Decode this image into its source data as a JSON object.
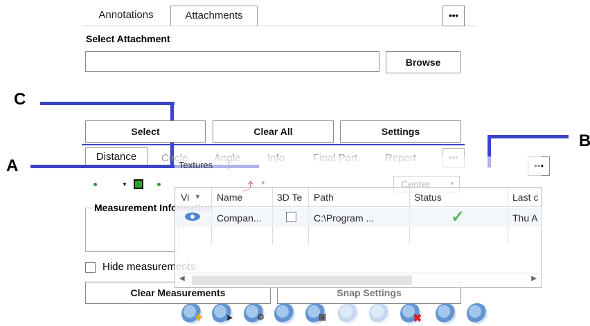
{
  "tabs": [
    {
      "label": "Annotations",
      "active": false
    },
    {
      "label": "Attachments",
      "active": true
    }
  ],
  "more_label": "•••",
  "select_attachment_label": "Select Attachment",
  "attachment_path_value": "",
  "browse_label": "Browse",
  "callouts": {
    "a": "A",
    "b": "B",
    "c": "C"
  },
  "buttons": {
    "select": "Select",
    "clear_all": "Clear All",
    "settings": "Settings"
  },
  "measure_tabs": [
    "Distance",
    "Circle",
    "Angle",
    "Info",
    "Final Part",
    "Report"
  ],
  "textures": {
    "title": "Textures",
    "combo_value": "Center",
    "columns": [
      "Vi",
      "Name",
      "3D Te",
      "Path",
      "Status",
      "Last c"
    ],
    "rows": [
      {
        "name": "Compan...",
        "path": "C:\\Program ...",
        "last": "Thu A",
        "status": "ok"
      }
    ]
  },
  "measurement_info_label": "Measurement Information",
  "hide_measurements_label": "Hide measurements",
  "clear_measurements_label": "Clear Measurements",
  "snap_settings_label": "Snap Settings",
  "colors": {
    "accent_bar": "#3b44c8",
    "check_green": "#5cb85c"
  },
  "toolbar_icons": [
    "add-texture-icon",
    "select-texture-icon",
    "texture-settings-icon",
    "edit-texture-icon",
    "texture-image-icon",
    "texture-save-icon",
    "texture-remove-icon",
    "texture-delete-icon",
    "texture-view-icon",
    "texture-visibility-icon"
  ]
}
